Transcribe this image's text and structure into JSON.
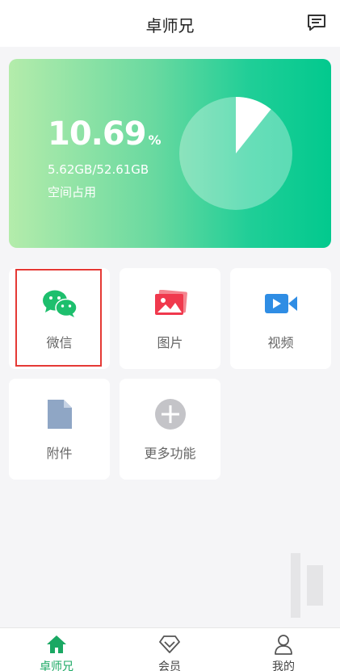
{
  "header": {
    "title": "卓师兄"
  },
  "storage": {
    "percent": "10.69",
    "percent_symbol": "%",
    "usage": "5.62GB/52.61GB",
    "label": "空间占用",
    "used_fraction": 0.1069
  },
  "tiles": [
    {
      "label": "微信",
      "icon": "wechat-icon"
    },
    {
      "label": "图片",
      "icon": "image-icon"
    },
    {
      "label": "视频",
      "icon": "video-icon"
    },
    {
      "label": "附件",
      "icon": "file-icon"
    },
    {
      "label": "更多功能",
      "icon": "plus-icon"
    }
  ],
  "tabbar": {
    "active_index": 0,
    "items": [
      {
        "label": "卓师兄",
        "icon": "home-icon"
      },
      {
        "label": "会员",
        "icon": "vip-diamond-icon"
      },
      {
        "label": "我的",
        "icon": "user-icon"
      }
    ]
  },
  "colors": {
    "accent": "#1aa863",
    "card_gradient_start": "#b4ecab",
    "card_gradient_end": "#02c98e",
    "highlight_border": "#e53935"
  }
}
